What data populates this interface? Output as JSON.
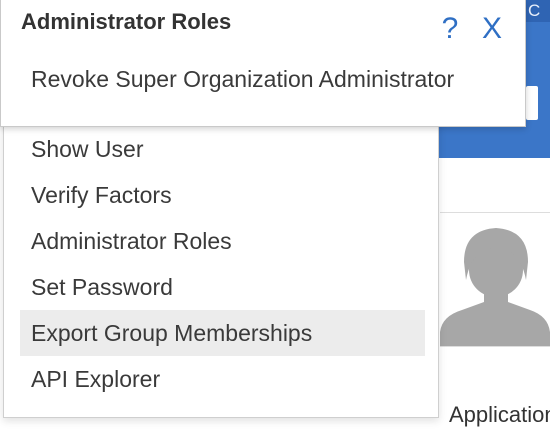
{
  "colors": {
    "accent": "#2f6fc4",
    "header_blue": "#3b76c8",
    "menu_highlight": "#ececec"
  },
  "background": {
    "topbar_fragment": "C C",
    "section_label": "Applications",
    "avatar_icon": "user-placeholder-icon"
  },
  "popover": {
    "title": "Administrator Roles",
    "help_glyph": "?",
    "close_glyph": "X",
    "option": "Revoke Super Organization Administrator"
  },
  "menu": {
    "items": [
      {
        "label": "Show User"
      },
      {
        "label": "Verify Factors"
      },
      {
        "label": "Administrator Roles"
      },
      {
        "label": "Set Password"
      },
      {
        "label": "Export Group Memberships",
        "highlighted": true
      },
      {
        "label": "API Explorer"
      }
    ]
  }
}
